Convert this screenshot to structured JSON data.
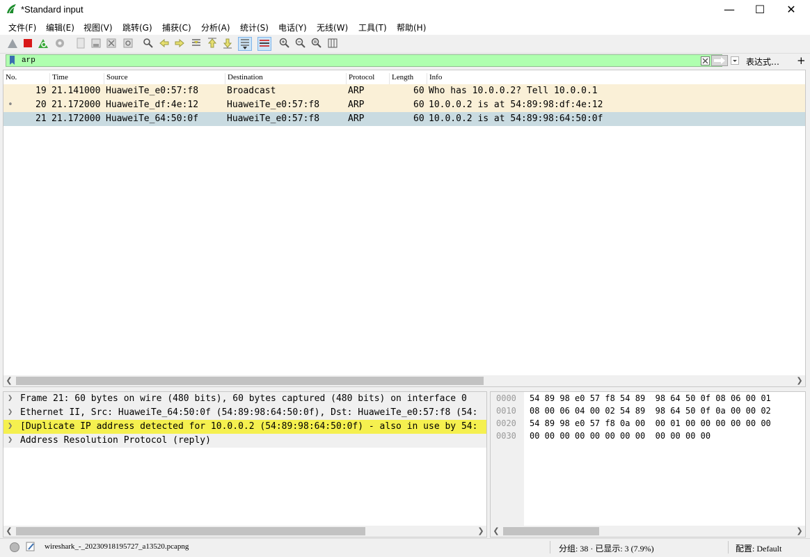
{
  "window": {
    "title": "*Standard input",
    "minimize": "—",
    "maximize": "☐",
    "close": "✕"
  },
  "menu": [
    "文件(F)",
    "编辑(E)",
    "视图(V)",
    "跳转(G)",
    "捕获(C)",
    "分析(A)",
    "统计(S)",
    "电话(Y)",
    "无线(W)",
    "工具(T)",
    "帮助(H)"
  ],
  "toolbar": {
    "icons": [
      "shark-fin-start-icon",
      "stop-capture-icon",
      "restart-capture-icon",
      "capture-options-icon",
      "open-file-icon",
      "save-file-icon",
      "close-file-icon",
      "reload-file-icon",
      "find-packet-icon",
      "go-back-icon",
      "go-forward-icon",
      "go-to-packet-icon",
      "go-first-icon",
      "go-last-icon",
      "auto-scroll-icon",
      "colorize-icon",
      "zoom-in-icon",
      "zoom-out-icon",
      "zoom-normal-icon",
      "resize-columns-icon"
    ]
  },
  "filter": {
    "value": "arp",
    "expression_label": "表达式…",
    "add_label": "+",
    "background": "#afffaf"
  },
  "packet_list": {
    "columns": [
      "No.",
      "Time",
      "Source",
      "Destination",
      "Protocol",
      "Length",
      "Info"
    ],
    "rows": [
      {
        "no": "19",
        "time": "21.141000",
        "source": "HuaweiTe_e0:57:f8",
        "destination": "Broadcast",
        "protocol": "ARP",
        "length": "60",
        "info": "Who has 10.0.0.2? Tell 10.0.0.1",
        "color": "#faf0d7",
        "marker": ""
      },
      {
        "no": "20",
        "time": "21.172000",
        "source": "HuaweiTe_df:4e:12",
        "destination": "HuaweiTe_e0:57:f8",
        "protocol": "ARP",
        "length": "60",
        "info": "10.0.0.2 is at 54:89:98:df:4e:12",
        "color": "#faf0d7",
        "marker": "•"
      },
      {
        "no": "21",
        "time": "21.172000",
        "source": "HuaweiTe_64:50:0f",
        "destination": "HuaweiTe_e0:57:f8",
        "protocol": "ARP",
        "length": "60",
        "info": "10.0.0.2 is at 54:89:98:64:50:0f",
        "color": "#c9dbe1",
        "marker": ""
      }
    ]
  },
  "details": [
    {
      "text": "Frame 21: 60 bytes on wire (480 bits), 60 bytes captured (480 bits) on interface 0",
      "highlight": false
    },
    {
      "text": "Ethernet II, Src: HuaweiTe_64:50:0f (54:89:98:64:50:0f), Dst: HuaweiTe_e0:57:f8 (54:",
      "highlight": false
    },
    {
      "text": "[Duplicate IP address detected for 10.0.0.2 (54:89:98:64:50:0f) - also in use by 54:",
      "highlight": true
    },
    {
      "text": "Address Resolution Protocol (reply)",
      "highlight": false
    }
  ],
  "bytes": [
    {
      "offset": "0000",
      "hex": "54 89 98 e0 57 f8 54 89  98 64 50 0f 08 06 00 01"
    },
    {
      "offset": "0010",
      "hex": "08 00 06 04 00 02 54 89  98 64 50 0f 0a 00 00 02"
    },
    {
      "offset": "0020",
      "hex": "54 89 98 e0 57 f8 0a 00  00 01 00 00 00 00 00 00"
    },
    {
      "offset": "0030",
      "hex": "00 00 00 00 00 00 00 00  00 00 00 00"
    }
  ],
  "status": {
    "file": "wireshark_-_20230918195727_a13520.pcapng",
    "packets": "分组: 38 · 已显示: 3 (7.9%)",
    "profile": "配置: Default"
  },
  "colors": {
    "highlight_yellow": "#f5f04f",
    "detail_bg": "#f0f0f0",
    "selected_row": "#c9dbe1"
  }
}
